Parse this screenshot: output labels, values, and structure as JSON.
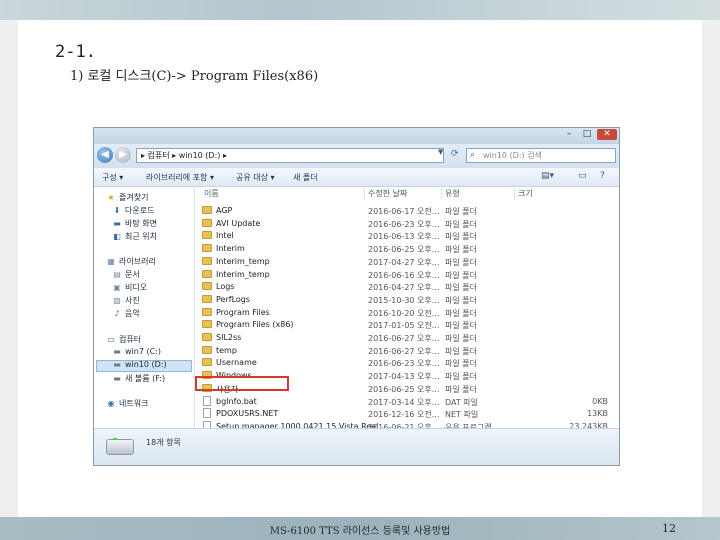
{
  "slide": {
    "heading": "2-1.",
    "subheading": "1) 로컬 디스크(C)-> Program Files(x86)",
    "footer": "MS-6100 TTS 라이선스 등록및 사용방법",
    "page_number": "12"
  },
  "window": {
    "controls": {
      "minimize": "–",
      "maximize": "□",
      "close": "✕"
    },
    "address": "▸ 컴퓨터 ▸ win10 (D:) ▸",
    "search_placeholder": "win10 (D:) 검색"
  },
  "toolbar": {
    "organize": "구성 ▾",
    "include_library": "라이브러리에 포함 ▾",
    "share_with": "공유 대상 ▾",
    "new_folder": "새 폴더",
    "view_icon": "view-options-icon"
  },
  "nav": {
    "favorites": "즐겨찾기",
    "favorites_items": [
      "다운로드",
      "바탕 화면",
      "최근 위치"
    ],
    "libraries": "라이브러리",
    "libraries_items": [
      "문서",
      "비디오",
      "사진",
      "음악"
    ],
    "computer": "컴퓨터",
    "computer_items": [
      "win7 (C:)",
      "win10 (D:)",
      "새 볼륨 (F:)"
    ],
    "network": "네트워크"
  },
  "columns": {
    "name": "이름",
    "date": "수정한 날짜",
    "type": "유형",
    "size": "크기"
  },
  "files": [
    {
      "name": "AGP",
      "date": "2016-06-17 오전...",
      "type": "파일 폴더",
      "size": "",
      "kind": "folder"
    },
    {
      "name": "AVI Update",
      "date": "2016-06-23 오후...",
      "type": "파일 폴더",
      "size": "",
      "kind": "folder"
    },
    {
      "name": "Intel",
      "date": "2016-06-13 오후...",
      "type": "파일 폴더",
      "size": "",
      "kind": "folder"
    },
    {
      "name": "Interim",
      "date": "2016-06-25 오후...",
      "type": "파일 폴더",
      "size": "",
      "kind": "folder"
    },
    {
      "name": "Interim_temp",
      "date": "2017-04-27 오후...",
      "type": "파일 폴더",
      "size": "",
      "kind": "folder"
    },
    {
      "name": "Interim_temp",
      "date": "2016-06-16 오후...",
      "type": "파일 폴더",
      "size": "",
      "kind": "folder"
    },
    {
      "name": "Logs",
      "date": "2016-04-27 오후...",
      "type": "파일 폴더",
      "size": "",
      "kind": "folder"
    },
    {
      "name": "PerfLogs",
      "date": "2015-10-30 오후...",
      "type": "파일 폴더",
      "size": "",
      "kind": "folder"
    },
    {
      "name": "Program Files",
      "date": "2016-10-20 오전...",
      "type": "파일 폴더",
      "size": "",
      "kind": "folder"
    },
    {
      "name": "Program Files (x86)",
      "date": "2017-01-05 오전...",
      "type": "파일 폴더",
      "size": "",
      "kind": "folder"
    },
    {
      "name": "SIL2ss",
      "date": "2016-06-27 오후...",
      "type": "파일 폴더",
      "size": "",
      "kind": "folder"
    },
    {
      "name": "temp",
      "date": "2016-06-27 오후...",
      "type": "파일 폴더",
      "size": "",
      "kind": "folder"
    },
    {
      "name": "Username",
      "date": "2016-06-23 오후...",
      "type": "파일 폴더",
      "size": "",
      "kind": "folder"
    },
    {
      "name": "Windows",
      "date": "2017-04-13 오후...",
      "type": "파일 폴더",
      "size": "",
      "kind": "folder"
    },
    {
      "name": "사용자",
      "date": "2016-06-25 오후...",
      "type": "파일 폴더",
      "size": "",
      "kind": "folder"
    },
    {
      "name": "bgInfo.bat",
      "date": "2017-03-14 오후...",
      "type": "DAT 파일",
      "size": "0KB",
      "kind": "file"
    },
    {
      "name": "PDOXUSRS.NET",
      "date": "2016-12-16 오전...",
      "type": "NET 파일",
      "size": "13KB",
      "kind": "file"
    },
    {
      "name": "Setup manager 1000.0421.15 Vista Real",
      "date": "2016-06-21 오후...",
      "type": "응용 프로그램",
      "size": "23,243KB",
      "kind": "file"
    }
  ],
  "status_bar": {
    "text": "18개 항목"
  }
}
